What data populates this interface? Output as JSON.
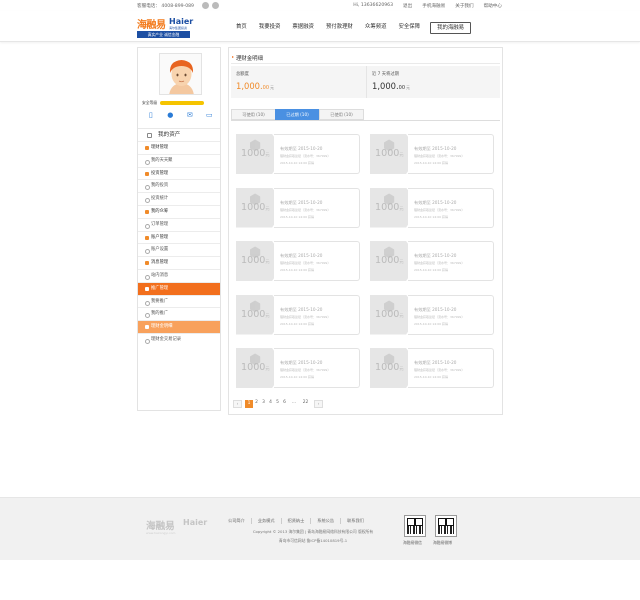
{
  "topbar": {
    "hotline": "客服电话：  4008-899-089",
    "greeting": "Hi, 13636620963",
    "logout": "退出",
    "mobile": "手机海融易",
    "about": "关于我们",
    "help": "帮助中心"
  },
  "logo": {
    "brand_cn": "海融易",
    "brand_en": "Haier",
    "brand_sub": "海尔集团投资",
    "slogan": "真实产业  诚信金融"
  },
  "nav": {
    "items": [
      "首页",
      "我要投资",
      "票据融资",
      "预付款理财",
      "众筹频道",
      "安全保障"
    ],
    "active": "我的海融易"
  },
  "sidebar": {
    "security_label": "安全等级",
    "security_level": 0.8,
    "icons": [
      "phone-icon",
      "user-icon",
      "message-icon",
      "card-icon"
    ],
    "menu_title": "我的资产",
    "items": [
      {
        "label": "理财管理",
        "type": "grp",
        "state": ""
      },
      {
        "label": "我的天天聚",
        "type": "sub",
        "state": ""
      },
      {
        "label": "投资管理",
        "type": "grp",
        "state": ""
      },
      {
        "label": "我的投资",
        "type": "sub",
        "state": ""
      },
      {
        "label": "投资统计",
        "type": "sub",
        "state": ""
      },
      {
        "label": "我的众筹",
        "type": "grp",
        "state": ""
      },
      {
        "label": "订单管理",
        "type": "sub",
        "state": ""
      },
      {
        "label": "账户管理",
        "type": "grp",
        "state": ""
      },
      {
        "label": "账户设置",
        "type": "sub",
        "state": ""
      },
      {
        "label": "消息管理",
        "type": "grp",
        "state": ""
      },
      {
        "label": "站内消息",
        "type": "sub",
        "state": ""
      },
      {
        "label": "推广管理",
        "type": "grp",
        "state": "hi"
      },
      {
        "label": "我要推广",
        "type": "sub",
        "state": ""
      },
      {
        "label": "我的推广",
        "type": "sub",
        "state": ""
      },
      {
        "label": "理财金明细",
        "type": "grp",
        "state": "hi2"
      },
      {
        "label": "理财金交易记录",
        "type": "sub",
        "state": ""
      }
    ]
  },
  "main": {
    "title": "理财金明细",
    "total_label": "总额度",
    "total_value": "1,000.",
    "total_dec": "00",
    "total_unit": "元",
    "expiring_label": "近 7 天将过期",
    "expiring_value": "1,000.",
    "expiring_dec": "00",
    "expiring_unit": "元",
    "tabs": [
      {
        "label": "可使用 (10)",
        "active": false
      },
      {
        "label": "已过期 (10)",
        "active": true
      },
      {
        "label": "已使用 (10)",
        "active": false
      }
    ],
    "coupon": {
      "amount": "1000",
      "unit": "元",
      "line1": "有效期至 2015-10-20",
      "line2": "理财金获取途径（流水号：367999）",
      "line3": "2015-10-10 14:00 获得"
    },
    "coupon_count": 10,
    "pager": [
      "1",
      "2",
      "3",
      "4",
      "5",
      "6",
      "...",
      "22"
    ],
    "pager_current": "1",
    "prev": "‹",
    "next": "›"
  },
  "footer": {
    "logo_cn": "海融易",
    "logo_en": "Haier",
    "logo_sub": "www.hairongyi.com",
    "links": [
      "公司简介",
      "业务模式",
      "招贤纳士",
      "系统公告",
      "联系我们"
    ],
    "copyright": "Copyright © 2013   海尔集团 | 青岛海融易网络科技有限公司 版权所有",
    "icp": "青岛市可信网站  鲁ICP备14010819号-1",
    "qr1": "海融易微信",
    "qr2": "海融易微博"
  }
}
